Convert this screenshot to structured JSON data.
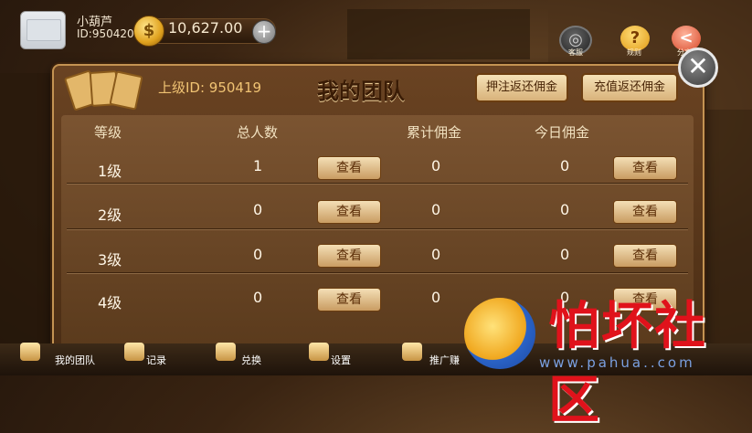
{
  "player": {
    "nickname": "小葫芦",
    "id_text": "ID:950420",
    "coins": "10,627.00",
    "coin_symbol": "$",
    "add_symbol": "+"
  },
  "top_icons": [
    {
      "label": "客服",
      "icon": "headset-icon",
      "glyph": "◎"
    },
    {
      "label": "规则",
      "icon": "question-icon",
      "glyph": "?"
    },
    {
      "label": "分享",
      "icon": "share-icon",
      "glyph": "<"
    }
  ],
  "panel": {
    "superior_id": "上级ID: 950419",
    "title": "我的团队",
    "deposit_rebate_button": "押注返还佣金",
    "recharge_rebate_button": "充值返还佣金",
    "close_glyph": "✕",
    "headers": [
      "等级",
      "总人数",
      "累计佣金",
      "今日佣金"
    ],
    "view_label": "查看",
    "rows": [
      {
        "level": "1级",
        "total": "1",
        "accum": "0",
        "today": "0"
      },
      {
        "level": "2级",
        "total": "0",
        "accum": "0",
        "today": "0"
      },
      {
        "level": "3级",
        "total": "0",
        "accum": "0",
        "today": "0"
      },
      {
        "level": "4级",
        "total": "0",
        "accum": "0",
        "today": "0"
      }
    ]
  },
  "bottom_nav": [
    {
      "label": "我的团队",
      "icon": "team-icon"
    },
    {
      "label": "记录",
      "icon": "record-icon"
    },
    {
      "label": "兑换",
      "icon": "exchange-icon"
    },
    {
      "label": "设置",
      "icon": "settings-icon"
    },
    {
      "label": "推广赚",
      "icon": "promote-icon"
    }
  ],
  "watermark": {
    "text": "怕坏社区",
    "url": "www.pahua..com"
  },
  "colors": {
    "panel_bg": "#5a3a1c",
    "gold_border": "#c49352",
    "button_cream": "#f4dfb6",
    "watermark_red": "#e0121b"
  }
}
